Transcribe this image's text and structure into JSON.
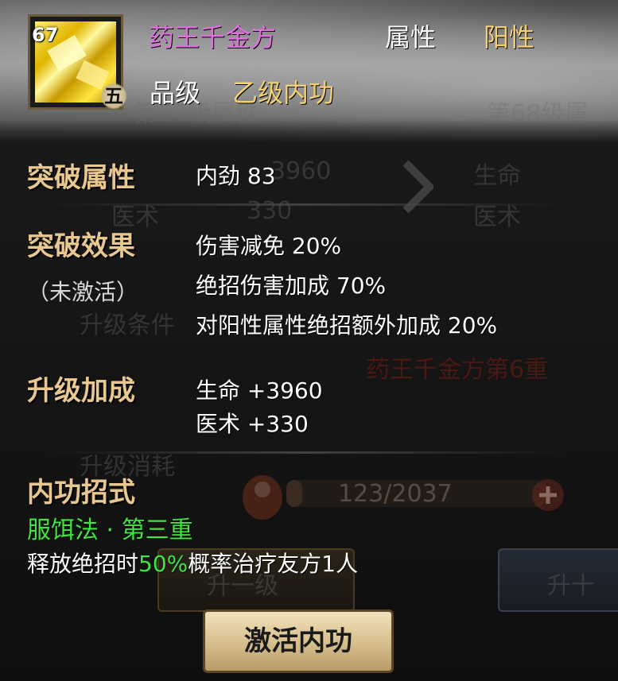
{
  "item": {
    "name": "药王千金方",
    "level": "67",
    "grade_seal": "五",
    "attribute_label": "属性",
    "attribute_value": "阳性",
    "grade_label": "品级",
    "grade_value": "乙级内功"
  },
  "breakthrough_attr": {
    "title": "突破属性",
    "stat": "内劲 83"
  },
  "breakthrough_effect": {
    "title": "突破效果",
    "status": "（未激活）",
    "lines": [
      "伤害减免 20%",
      "绝招伤害加成 70%",
      "对阳性属性绝招额外加成 20%"
    ]
  },
  "upgrade_bonus": {
    "title": "升级加成",
    "lines": [
      "生命 +3960",
      "医术 +330"
    ]
  },
  "skill": {
    "title": "内功招式",
    "name": "服饵法 · 第三重",
    "desc_prefix": "释放绝招时",
    "desc_percent": "50%",
    "desc_suffix": "概率治疗友方1人"
  },
  "background": {
    "header_text": "第67级属性",
    "header_right": "第68级属",
    "row1_left": "医术",
    "row1_val": "330",
    "row1_right_a": "生命",
    "row1_right_b": "医术",
    "row0_val": "3960",
    "condition": "升级条件",
    "condition_right": "药王千金方第6重",
    "cost": "升级消耗",
    "progress_text": "123/2037",
    "button_left": "升一级",
    "button_right": "升十"
  },
  "activate_button": "激活内功",
  "colors": {
    "title_purple": "#e070e0",
    "gold": "#f4d070",
    "section_tan": "#e8c890",
    "green": "#3ee63e"
  }
}
